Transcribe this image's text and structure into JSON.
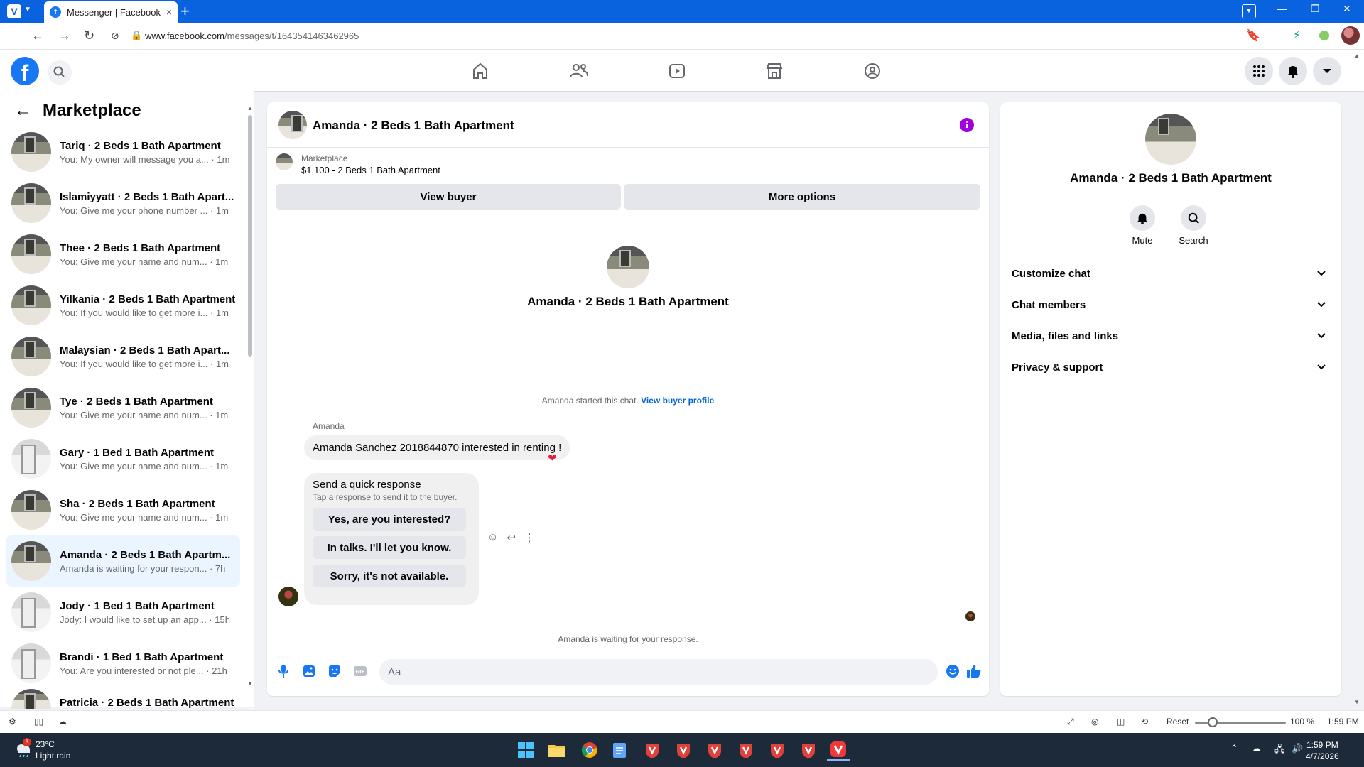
{
  "browser": {
    "tab_title": "Messenger | Facebook",
    "url_domain": "www.facebook.com",
    "url_path": "/messages/t/1643541463462965",
    "new_tab": "+",
    "status": {
      "reset": "Reset",
      "zoom": "100 %",
      "time": "1:59 PM"
    }
  },
  "header": {
    "logo": "f"
  },
  "left_panel": {
    "title": "Marketplace",
    "conversations": [
      {
        "name": "Tariq · 2 Beds 1 Bath Apartment",
        "snippet": "You: My owner will message you a... · 1m"
      },
      {
        "name": "Islamiyyatt · 2 Beds 1 Bath Apart...",
        "snippet": "You: Give me your phone number ... · 1m"
      },
      {
        "name": "Thee · 2 Beds 1 Bath Apartment",
        "snippet": "You: Give me your name and num... · 1m"
      },
      {
        "name": "Yilkania · 2 Beds 1 Bath Apartment",
        "snippet": "You: If you would like to get more i... · 1m"
      },
      {
        "name": "Malaysian · 2 Beds 1 Bath Apart...",
        "snippet": "You: If you would like to get more i... · 1m"
      },
      {
        "name": "Tye · 2 Beds 1 Bath Apartment",
        "snippet": "You: Give me your name and num... · 1m"
      },
      {
        "name": "Gary · 1 Bed 1 Bath Apartment",
        "snippet": "You: Give me your name and num... · 1m"
      },
      {
        "name": "Sha · 2 Beds 1 Bath Apartment",
        "snippet": "You: Give me your name and num... · 1m"
      },
      {
        "name": "Amanda · 2 Beds 1 Bath Apartm...",
        "snippet": "Amanda is waiting for your respon... · 7h"
      },
      {
        "name": "Jody · 1 Bed 1 Bath Apartment",
        "snippet": "Jody: I would like to set up an app... · 15h"
      },
      {
        "name": "Brandi · 1 Bed 1 Bath Apartment",
        "snippet": "You: Are you interested or not ple... · 21h"
      },
      {
        "name": "Patricia · 2 Beds 1 Bath Apartment",
        "snippet": ""
      }
    ]
  },
  "chat": {
    "title": "Amanda · 2 Beds 1 Bath Apartment",
    "info": "i",
    "marketplace_label": "Marketplace",
    "listing": "$1,100 - 2 Beds 1 Bath Apartment",
    "view_buyer": "View buyer",
    "more_options": "More options",
    "center_name": "Amanda · 2 Beds 1 Bath Apartment",
    "started_text": "Amanda started this chat.",
    "view_buyer_profile": "View buyer profile",
    "sender": "Amanda",
    "message": "Amanda Sanchez 2018844870 interested in renting !",
    "reaction": "❤",
    "quick_title": "Send a quick response",
    "quick_sub": "Tap a response to send it to the buyer.",
    "quick_responses": [
      "Yes, are you interested?",
      "In talks. I'll let you know.",
      "Sorry, it's not available."
    ],
    "waiting": "Amanda is waiting for your response.",
    "composer_placeholder": "Aa"
  },
  "right_panel": {
    "name": "Amanda · 2 Beds 1 Bath Apartment",
    "mute": "Mute",
    "search": "Search",
    "sections": [
      "Customize chat",
      "Chat members",
      "Media, files and links",
      "Privacy & support"
    ]
  },
  "taskbar": {
    "weather_badge": "3",
    "temp": "23°C",
    "weather": "Light rain",
    "time": "1:59 PM",
    "date": "4/7/2026"
  },
  "colors": {
    "fb_blue": "#1877f2",
    "vivaldi_blue": "#0a63de",
    "info_purple": "#a000e0",
    "heart": "#e41e3f"
  }
}
